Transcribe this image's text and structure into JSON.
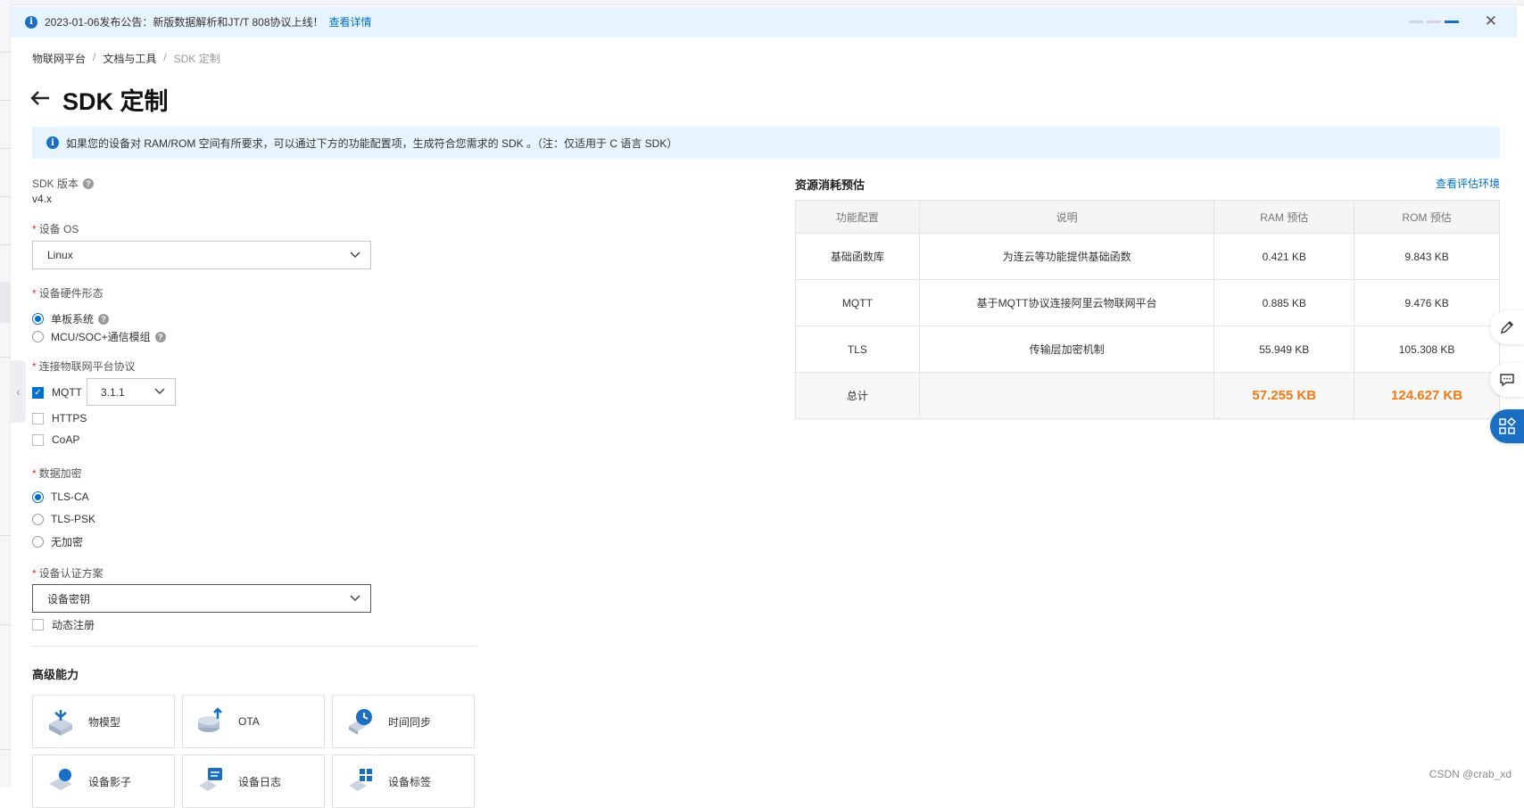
{
  "notice": {
    "text": "2023-01-06发布公告：新版数据解析和JT/T 808协议上线！",
    "link": "查看详情"
  },
  "breadcrumb": {
    "item1": "物联网平台",
    "item2": "文档与工具",
    "current": "SDK 定制",
    "sep": "/"
  },
  "page_title": "SDK 定制",
  "tip": "如果您的设备对 RAM/ROM 空间有所要求，可以通过下方的功能配置项，生成符合您需求的 SDK 。（注：仅适用于 C 语言 SDK）",
  "form": {
    "sdk_version_label": "SDK 版本",
    "sdk_version_value": "v4.x",
    "os_label": "设备 OS",
    "os_value": "Linux",
    "hardware_label": "设备硬件形态",
    "hardware_options": [
      "单板系统",
      "MCU/SOC+通信模组"
    ],
    "protocol_label": "连接物联网平台协议",
    "protocol_mqtt": "MQTT",
    "mqtt_version": "3.1.1",
    "protocol_https": "HTTPS",
    "protocol_coap": "CoAP",
    "encrypt_label": "数据加密",
    "encrypt_options": [
      "TLS-CA",
      "TLS-PSK",
      "无加密"
    ],
    "auth_label": "设备认证方案",
    "auth_value": "设备密钥",
    "dynamic_reg": "动态注册",
    "required_mark": "*"
  },
  "advanced": {
    "title": "高级能力",
    "cards": [
      "物模型",
      "OTA",
      "时间同步",
      "设备影子",
      "设备日志",
      "设备标签"
    ]
  },
  "resource": {
    "title": "资源消耗预估",
    "env_link": "查看评估环境",
    "columns": [
      "功能配置",
      "说明",
      "RAM 预估",
      "ROM 预估"
    ],
    "rows": [
      [
        "基础函数库",
        "为连云等功能提供基础函数",
        "0.421 KB",
        "9.843 KB"
      ],
      [
        "MQTT",
        "基于MQTT协议连接阿里云物联网平台",
        "0.885 KB",
        "9.476 KB"
      ],
      [
        "TLS",
        "传输层加密机制",
        "55.949 KB",
        "105.308 KB"
      ]
    ],
    "total_label": "总计",
    "total_ram": "57.255 KB",
    "total_rom": "124.627 KB",
    "accent_color": "#ef7a16"
  },
  "watermark": "CSDN @crab_xd",
  "icons": [
    "info-icon",
    "close-icon",
    "back-arrow-icon",
    "help-icon",
    "chevron-down-icon",
    "edit-icon",
    "chat-icon",
    "apps-icon",
    "collapse-icon"
  ],
  "colors": {
    "primary": "#0070cc",
    "notice_bg": "#e8f4fd",
    "required": "#d93026"
  }
}
